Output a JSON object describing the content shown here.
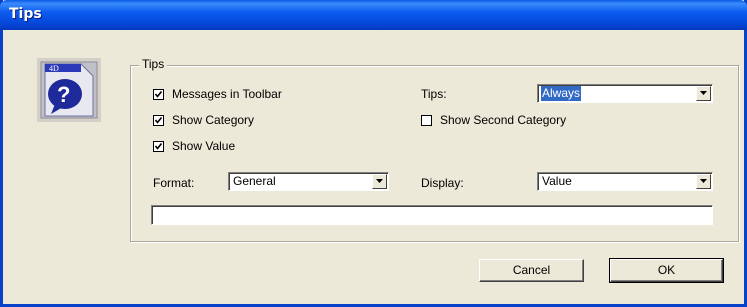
{
  "window": {
    "title": "Tips"
  },
  "logo": {
    "icon": "4d-help-icon",
    "badge_text": "4D"
  },
  "group": {
    "label": "Tips"
  },
  "options": {
    "messages_in_toolbar": {
      "label": "Messages in Toolbar",
      "checked": true
    },
    "show_category": {
      "label": "Show Category",
      "checked": true
    },
    "show_value": {
      "label": "Show Value",
      "checked": true
    },
    "show_second_category": {
      "label": "Show Second Category",
      "checked": false
    }
  },
  "tips": {
    "label": "Tips:",
    "value": "Always"
  },
  "format": {
    "label": "Format:",
    "value": "General"
  },
  "display": {
    "label": "Display:",
    "value": "Value"
  },
  "preview": {
    "value": ""
  },
  "buttons": {
    "cancel": "Cancel",
    "ok": "OK"
  }
}
